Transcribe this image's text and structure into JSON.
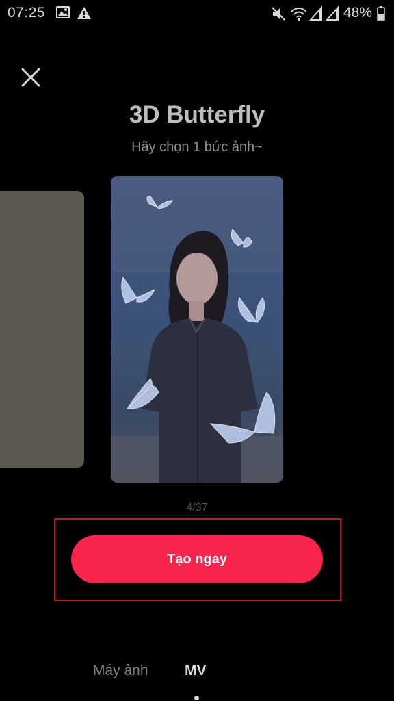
{
  "status_bar": {
    "time": "07:25",
    "battery": "48%",
    "icons": [
      "image-icon",
      "warning-icon",
      "mute-icon",
      "wifi-icon",
      "signal-icon",
      "signal-icon",
      "battery-icon"
    ]
  },
  "header": {
    "title": "3D Butterfly",
    "subtitle": "Hãy chọn 1 bức ảnh~"
  },
  "carousel": {
    "indicator": "4/37"
  },
  "actions": {
    "create_label": "Tạo ngay"
  },
  "bottom_tabs": [
    {
      "label": "Máy ảnh",
      "active": false
    },
    {
      "label": "MV",
      "active": true
    }
  ],
  "colors": {
    "accent": "#f9254f",
    "highlight": "#d0101c",
    "background": "#000000"
  }
}
